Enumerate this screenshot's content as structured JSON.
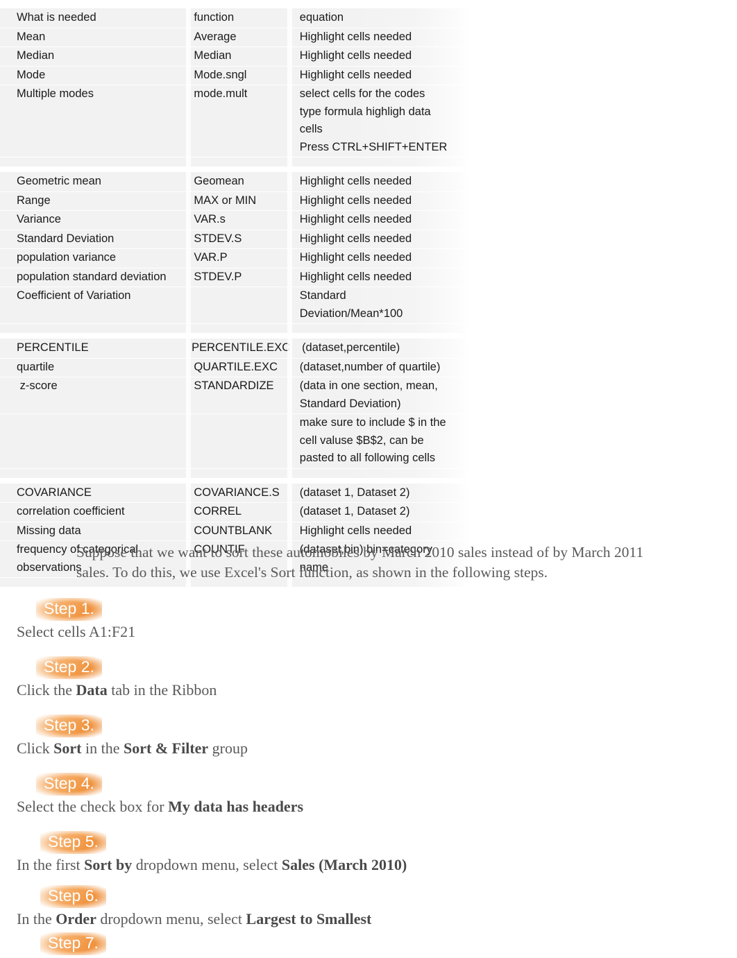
{
  "table": {
    "columns": [
      "What is needed",
      "function",
      "equation"
    ],
    "sections": [
      {
        "rows": [
          [
            "What is needed",
            "function",
            "equation"
          ],
          [
            "Mean",
            "Average",
            "Highlight cells needed"
          ],
          [
            "Median",
            "Median",
            "Highlight cells needed"
          ],
          [
            "Mode",
            "Mode.sngl",
            "Highlight cells needed"
          ],
          [
            "Multiple modes",
            "mode.mult",
            "select cells for the codes\ntype formula highligh data\ncells\nPress CTRL+SHIFT+ENTER"
          ]
        ]
      },
      {
        "rows": [
          [
            "Geometric mean",
            "Geomean",
            "Highlight cells needed"
          ],
          [
            "Range",
            "MAX or MIN",
            "Highlight cells needed"
          ],
          [
            "Variance",
            "VAR.s",
            "Highlight cells needed"
          ],
          [
            "Standard Deviation",
            "STDEV.S",
            "Highlight cells needed"
          ],
          [
            "population variance",
            "VAR.P",
            "Highlight cells needed"
          ],
          [
            "population standard deviation",
            "STDEV.P",
            "Highlight cells needed"
          ],
          [
            "Coefficient of Variation",
            "",
            "Standard\nDeviation/Mean*100"
          ]
        ]
      },
      {
        "rows": [
          [
            "PERCENTILE",
            "PERCENTILE.EXC",
            "(dataset,percentile)"
          ],
          [
            "quartile",
            "QUARTILE.EXC",
            "(dataset,number of quartile)"
          ],
          [
            " z-score",
            "STANDARDIZE",
            "(data in one section, mean,\nStandard Deviation)"
          ],
          [
            "",
            "",
            "make sure to include $ in the\ncell valuse $B$2, can be\npasted to all following cells"
          ]
        ]
      },
      {
        "rows": [
          [
            "COVARIANCE",
            "COVARIANCE.S",
            "(dataset 1, Dataset 2)"
          ],
          [
            "correlation coefficient",
            "CORREL",
            "(dataset 1, Dataset 2)"
          ],
          [
            "Missing data",
            "COUNTBLANK",
            "Highlight cells needed"
          ],
          [
            "frequency of categorical\nobservations",
            "COUNTIF",
            "(dataset,bin) bin=category\nname"
          ]
        ]
      }
    ]
  },
  "prose": {
    "intro": "Suppose that we want to sort these automobiles by March 2010 sales instead of by March 2011 sales. To do this, we use Excel's Sort function, as shown in the following steps."
  },
  "steps": [
    {
      "badge": "Step 1.",
      "text_parts": [
        {
          "t": "Select cells A1:F21",
          "b": false
        }
      ]
    },
    {
      "badge": "Step 2.",
      "text_parts": [
        {
          "t": "Click the ",
          "b": false
        },
        {
          "t": "Data",
          "b": true
        },
        {
          "t": " tab in the Ribbon",
          "b": false
        }
      ]
    },
    {
      "badge": "Step 3.",
      "text_parts": [
        {
          "t": "Click ",
          "b": false
        },
        {
          "t": "Sort",
          "b": true
        },
        {
          "t": " in the ",
          "b": false
        },
        {
          "t": "Sort & Filter",
          "b": true
        },
        {
          "t": " group",
          "b": false
        }
      ]
    },
    {
      "badge": "Step 4.",
      "text_parts": [
        {
          "t": "Select the check box for ",
          "b": false
        },
        {
          "t": "My data has headers",
          "b": true
        }
      ]
    },
    {
      "badge": "Step 5.",
      "text_parts": [
        {
          "t": "In the first ",
          "b": false
        },
        {
          "t": "Sort by",
          "b": true
        },
        {
          "t": " dropdown menu, select ",
          "b": false
        },
        {
          "t": "Sales (March 2010)",
          "b": true
        }
      ]
    },
    {
      "badge": "Step 6.",
      "text_parts": [
        {
          "t": "In the ",
          "b": false
        },
        {
          "t": "Order",
          "b": true
        },
        {
          "t": " dropdown menu, select ",
          "b": false
        },
        {
          "t": "Largest to Smallest",
          "b": true
        }
      ]
    },
    {
      "badge": "Step 7.",
      "text_parts": []
    }
  ],
  "colors": {
    "badge_light": "#f8c89a",
    "badge_dark": "#ec8a33",
    "table_bg": "#f2f2f2",
    "body_text": "#5a5a5a",
    "table_text": "#1a1a1a"
  }
}
